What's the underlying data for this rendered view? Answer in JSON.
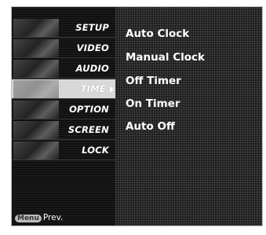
{
  "sidebar": {
    "items": [
      {
        "label": "SETUP",
        "icon": "satellite-icon",
        "active": false
      },
      {
        "label": "VIDEO",
        "icon": "film-icon",
        "active": false
      },
      {
        "label": "AUDIO",
        "icon": "speaker-icon",
        "active": false
      },
      {
        "label": "TIME",
        "icon": "clock-icon",
        "active": true
      },
      {
        "label": "OPTION",
        "icon": "option-icon",
        "active": false
      },
      {
        "label": "SCREEN",
        "icon": "screen-icon",
        "active": false
      },
      {
        "label": "LOCK",
        "icon": "lock-icon",
        "active": false
      }
    ]
  },
  "footer": {
    "menu_key": "Menu",
    "prev_label": "Prev."
  },
  "submenu": {
    "items": [
      {
        "label": "Auto Clock"
      },
      {
        "label": "Manual Clock"
      },
      {
        "label": "Off Timer"
      },
      {
        "label": "On Timer"
      },
      {
        "label": "Auto Off"
      }
    ]
  }
}
